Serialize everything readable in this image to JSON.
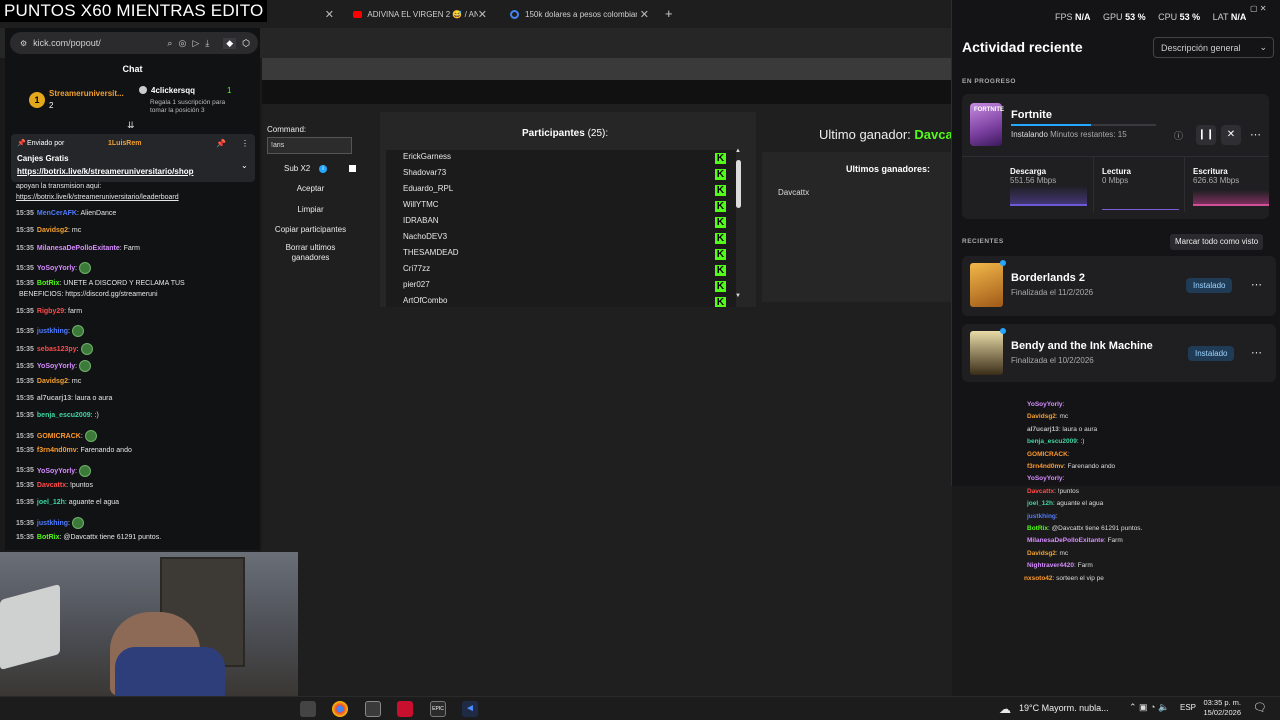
{
  "overlay": {
    "title": "PUNTOS X60 MIENTRAS EDITO"
  },
  "tabs": [
    {
      "label": "ADIVINA EL VIRGEN 2 😅 / ANI"
    },
    {
      "label": "150k dolares a pesos colombian"
    }
  ],
  "chat": {
    "url": "kick.com/popout/",
    "title": "Chat",
    "leader1": {
      "name": "Streameruniversit...",
      "count": "2"
    },
    "leader2": {
      "name": "4clickersqq",
      "count": "1",
      "sub": "Regala 1 suscripción para tomar la posición 3"
    },
    "pinned": {
      "sent_by": "Enviado por",
      "user": "1LuisRem",
      "text": "Canjes Gratis",
      "link": "https://botrix.live/k/streameruniversitario/shop"
    },
    "pre": "apoyan la transmision aqui:",
    "pre_link": "https://botrix.live/k/streameruniversitario/leaderboard",
    "messages": [
      {
        "time": "15:35",
        "user": "MenCerAFK",
        "color": "#4f7cff",
        "text": ": AlienDance"
      },
      {
        "time": "15:35",
        "user": "Davidsg2",
        "color": "#f0a030",
        "text": ": mc"
      },
      {
        "time": "15:35",
        "user": "MilanesaDePolloExitante",
        "color": "#d68cff",
        "text": ": Farm"
      },
      {
        "time": "15:35",
        "user": "YoSoyYorly",
        "color": "#d68cff",
        "text": ":"
      },
      {
        "time": "15:35",
        "user": "BotRix",
        "color": "#53fc18",
        "text": ": UNETE A DISCORD Y RECLAMA TUS"
      },
      {
        "time": "",
        "user": "",
        "color": "#fff",
        "text": "BENEFICIOS: https://discord.gg/streameruni"
      },
      {
        "time": "15:35",
        "user": "Rigby29",
        "color": "#ff4b4b",
        "text": ": farm"
      },
      {
        "time": "15:35",
        "user": "justkhing",
        "color": "#4f7cff",
        "text": ":"
      },
      {
        "time": "15:35",
        "user": "sebas123py",
        "color": "#ff4b4b",
        "text": ":"
      },
      {
        "time": "15:35",
        "user": "YoSoyYorly",
        "color": "#d68cff",
        "text": ":"
      },
      {
        "time": "15:35",
        "user": "Davidsg2",
        "color": "#f0a030",
        "text": ": mc"
      },
      {
        "time": "15:35",
        "user": "al7ucarj13",
        "color": "#bdbdbd",
        "text": ": laura o aura"
      },
      {
        "time": "15:35",
        "user": "benja_escu2009",
        "color": "#3fd6a0",
        "text": ": :)"
      },
      {
        "time": "15:35",
        "user": "GOMICRACK",
        "color": "#ff9a2e",
        "text": ":"
      },
      {
        "time": "15:35",
        "user": "f3rn4nd0mv",
        "color": "#ff9a2e",
        "text": ": Farenando ando"
      },
      {
        "time": "15:35",
        "user": "YoSoyYorly",
        "color": "#d68cff",
        "text": ":"
      },
      {
        "time": "15:35",
        "user": "Davcattx",
        "color": "#ff4b4b",
        "text": ": !puntos"
      },
      {
        "time": "15:35",
        "user": "joel_12h",
        "color": "#3fd6a0",
        "text": ": aguante el agua"
      },
      {
        "time": "15:35",
        "user": "justkhing",
        "color": "#4f7cff",
        "text": ":"
      },
      {
        "time": "15:35",
        "user": "BotRix",
        "color": "#53fc18",
        "text": ": @Davcattx tiene 61291 puntos."
      }
    ]
  },
  "tool": {
    "command_label": "Command:",
    "command_value": "!aris",
    "sub_label": "Sub X2",
    "aceptar": "Aceptar",
    "limpiar": "Limpiar",
    "copiar": "Copiar participantes",
    "borrar": "Borrar ultimos ganadores",
    "participants_title": "Participantes",
    "participants_count": "(25):",
    "participants": [
      "ErickGarness",
      "Shadovar73",
      "Eduardo_RPL",
      "WillYTMC",
      "IDRABAN",
      "NachoDEV3",
      "THESAMDEAD",
      "Cri77zz",
      "pier027",
      "ArtOfCombo"
    ],
    "last_winner_label": "Ultimo ganador:",
    "last_winner": "Davcat",
    "winners_title": "Ultimos ganadores:",
    "winners": [
      "Davcattx"
    ]
  },
  "epic": {
    "stats": {
      "fps": "FPS",
      "fps_val": "N/A",
      "gpu": "GPU",
      "gpu_val": "53 %",
      "cpu": "CPU",
      "cpu_val": "53 %",
      "lat": "LAT",
      "lat_val": "N/A"
    },
    "title": "Actividad reciente",
    "filter": "Descripción general",
    "in_progress": "EN PROGRESO",
    "game": "Fortnite",
    "status": "Instalando",
    "remaining": "Minutos restantes: 15",
    "progress": 0.55,
    "download_label": "Descarga",
    "download_val": "551.56 Mbps",
    "read_label": "Lectura",
    "read_val": "0 Mbps",
    "write_label": "Escritura",
    "write_val": "626.63 Mbps",
    "recent": "RECIENTES",
    "mark_all": "Marcar todo como visto",
    "recents": [
      {
        "name": "Borderlands 2",
        "date": "Finalizada el 11/2/2026",
        "state": "Instalado"
      },
      {
        "name": "Bendy and the Ink Machine",
        "date": "Finalizada el 10/2/2026",
        "state": "Instalado"
      }
    ]
  },
  "echo": [
    {
      "user": "YoSoyYorly",
      "color": "#d68cff",
      "text": ":"
    },
    {
      "user": "Davidsg2",
      "color": "#f0a030",
      "text": ": mc"
    },
    {
      "user": "al7ucarj13",
      "color": "#bdbdbd",
      "text": ": laura o aura"
    },
    {
      "user": "benja_escu2009",
      "color": "#3fd6a0",
      "text": ": :)"
    },
    {
      "user": "GOMICRACK",
      "color": "#ff9a2e",
      "text": ":"
    },
    {
      "user": "f3rn4nd0mv",
      "color": "#ff9a2e",
      "text": ": Farenando ando"
    },
    {
      "user": "YoSoyYorly",
      "color": "#d68cff",
      "text": ":"
    },
    {
      "user": "Davcattx",
      "color": "#ff4b4b",
      "text": ": !puntos"
    },
    {
      "user": "joel_12h",
      "color": "#3fd6a0",
      "text": ": aguante el agua"
    },
    {
      "user": "justkhing",
      "color": "#4f7cff",
      "text": ":"
    },
    {
      "user": "BotRix",
      "color": "#53fc18",
      "text": ": @Davcattx tiene 61291 puntos."
    },
    {
      "user": "MilanesaDePolloExitante",
      "color": "#d68cff",
      "text": ": Farm"
    },
    {
      "user": "Davidsg2",
      "color": "#f0a030",
      "text": ": mc"
    },
    {
      "user": "Nightraver4420",
      "color": "#d68cff",
      "text": ": Farm"
    },
    {
      "user": "nxsoto42",
      "color": "#ff9a2e",
      "text": ": sorteen el vip pe"
    }
  ],
  "taskbar": {
    "weather": "19°C  Mayorm. nubla...",
    "lang": "ESP",
    "time": "03:35 p. m.",
    "date": "15/02/2026"
  },
  "colors": {
    "kick_green": "#53fc18",
    "accent_blue": "#26a7ff"
  }
}
